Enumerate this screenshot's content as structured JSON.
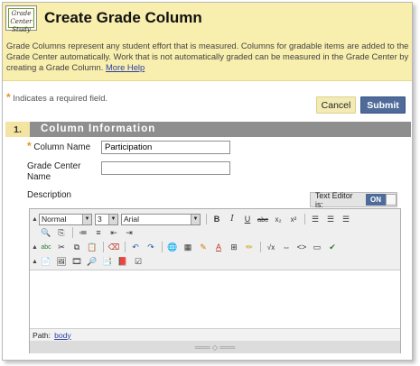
{
  "header": {
    "title": "Create Grade Column",
    "logo_text": "Grade Center Study",
    "description": "Grade Columns represent any student effort that is measured. Columns for gradable items are added to the Grade Center automatically. Work that is not automatically graded can be measured in the Grade Center by creating a Grade Column.",
    "more_help": "More Help"
  },
  "required_note": "Indicates a required field.",
  "actions": {
    "cancel": "Cancel",
    "submit": "Submit"
  },
  "section": {
    "number": "1.",
    "title": "Column Information"
  },
  "fields": {
    "column_name_label": "Column Name",
    "column_name_value": "Participation",
    "grade_center_name_label": "Grade Center Name",
    "grade_center_name_value": "",
    "description_label": "Description"
  },
  "editor": {
    "text_editor_label": "Text Editor is:",
    "toggle_state": "ON",
    "format_value": "Normal",
    "size_value": "3",
    "font_value": "Arial",
    "path_label": "Path:",
    "path_value": "body"
  }
}
